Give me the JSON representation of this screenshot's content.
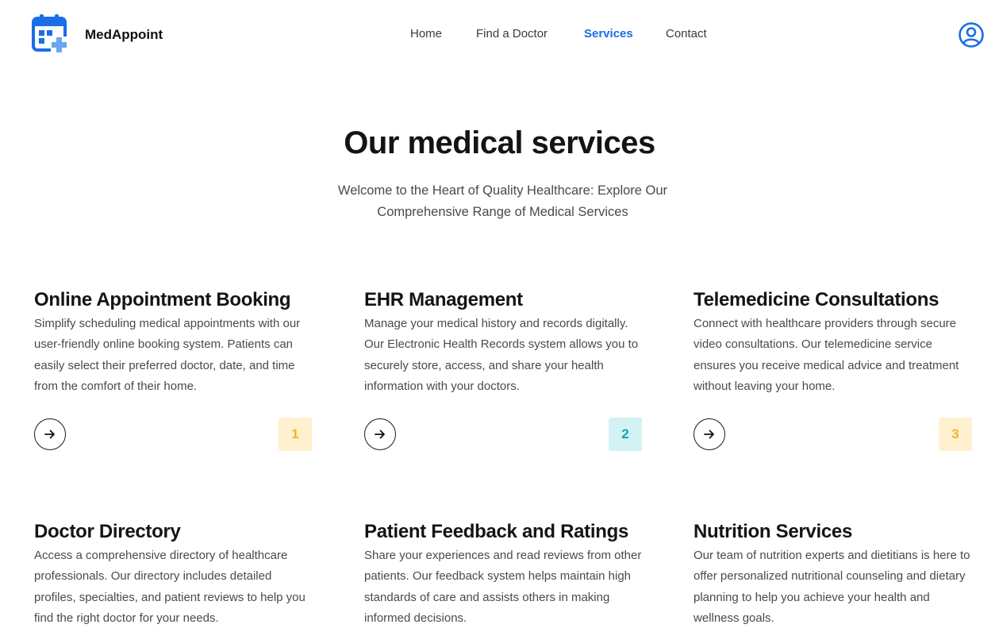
{
  "header": {
    "brand": "MedAppoint",
    "logo_icon": "calendar-plus-icon",
    "nav": [
      "Home",
      "Find a Doctor",
      "Services",
      "Contact"
    ],
    "active_nav": "Services",
    "user_icon": "user-circle-icon",
    "accent": "#1a6ee6"
  },
  "hero": {
    "title": "Our medical services",
    "subtitle": "Welcome to the Heart of Quality Healthcare: Explore Our Comprehensive Range of Medical Services"
  },
  "services": [
    {
      "title": "Online Appointment Booking",
      "description": "Simplify scheduling medical appointments with our user-friendly online booking system. Patients can easily select their preferred doctor, date, and time from the comfort of their home.",
      "number": "1",
      "badge_bg": "#fff0cf",
      "badge_fg": "#f0b429"
    },
    {
      "title": "EHR Management",
      "description": "Manage your medical history and records digitally. Our Electronic Health Records system allows you to securely store, access, and share your health information with your doctors.",
      "number": "2",
      "badge_bg": "#d3f2f4",
      "badge_fg": "#18a6b3"
    },
    {
      "title": "Telemedicine Consultations",
      "description": "Connect with healthcare providers through secure video consultations. Our telemedicine service ensures you receive medical advice and treatment without leaving your home.",
      "number": "3",
      "badge_bg": "#fff0cf",
      "badge_fg": "#f0b429"
    },
    {
      "title": "Doctor Directory",
      "description": "Access a comprehensive directory of healthcare professionals. Our directory includes detailed profiles, specialties, and patient reviews to help you find the right doctor for your needs."
    },
    {
      "title": "Patient Feedback and Ratings",
      "description": "Share your experiences and read reviews from other patients. Our feedback system helps maintain high standards of care and assists others in making informed decisions."
    },
    {
      "title": "Nutrition Services",
      "description": "Our team of nutrition experts and dietitians is here to offer personalized nutritional counseling and dietary planning to help you achieve your health and wellness goals."
    }
  ],
  "arrow_icon": "arrow-right-icon"
}
